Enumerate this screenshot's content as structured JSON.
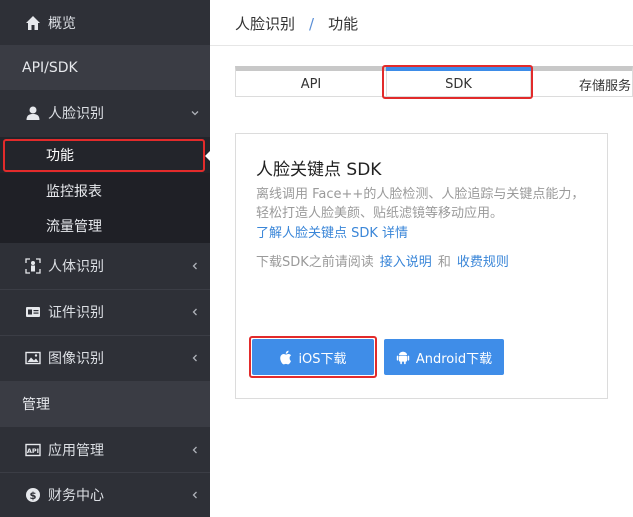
{
  "sidebar": {
    "overview": "概览",
    "section_api": "API/SDK",
    "face": "人脸识别",
    "face_sub": [
      "功能",
      "监控报表",
      "流量管理"
    ],
    "body": "人体识别",
    "id": "证件识别",
    "image": "图像识别",
    "section_manage": "管理",
    "app": "应用管理",
    "finance": "财务中心"
  },
  "breadcrumb": {
    "first": "人脸识别",
    "sep": "/",
    "second": "功能"
  },
  "tabs": [
    "API",
    "SDK",
    "存储服务"
  ],
  "card": {
    "title": "人脸关键点 SDK",
    "desc": "离线调用 Face++的人脸检测、人脸追踪与关键点能力，轻松打造人脸美颜、贴纸滤镜等移动应用。",
    "link": "了解人脸关键点 SDK 详情",
    "note_prefix": "下载SDK之前请阅读",
    "note_link1": "接入说明",
    "note_and": "和",
    "note_link2": "收费规则"
  },
  "buttons": {
    "ios": "iOS下载",
    "android": "Android下载"
  },
  "colors": {
    "sidebar_bg": "#2e3037",
    "accent": "#3f8de8",
    "highlight": "#e22b2b"
  }
}
